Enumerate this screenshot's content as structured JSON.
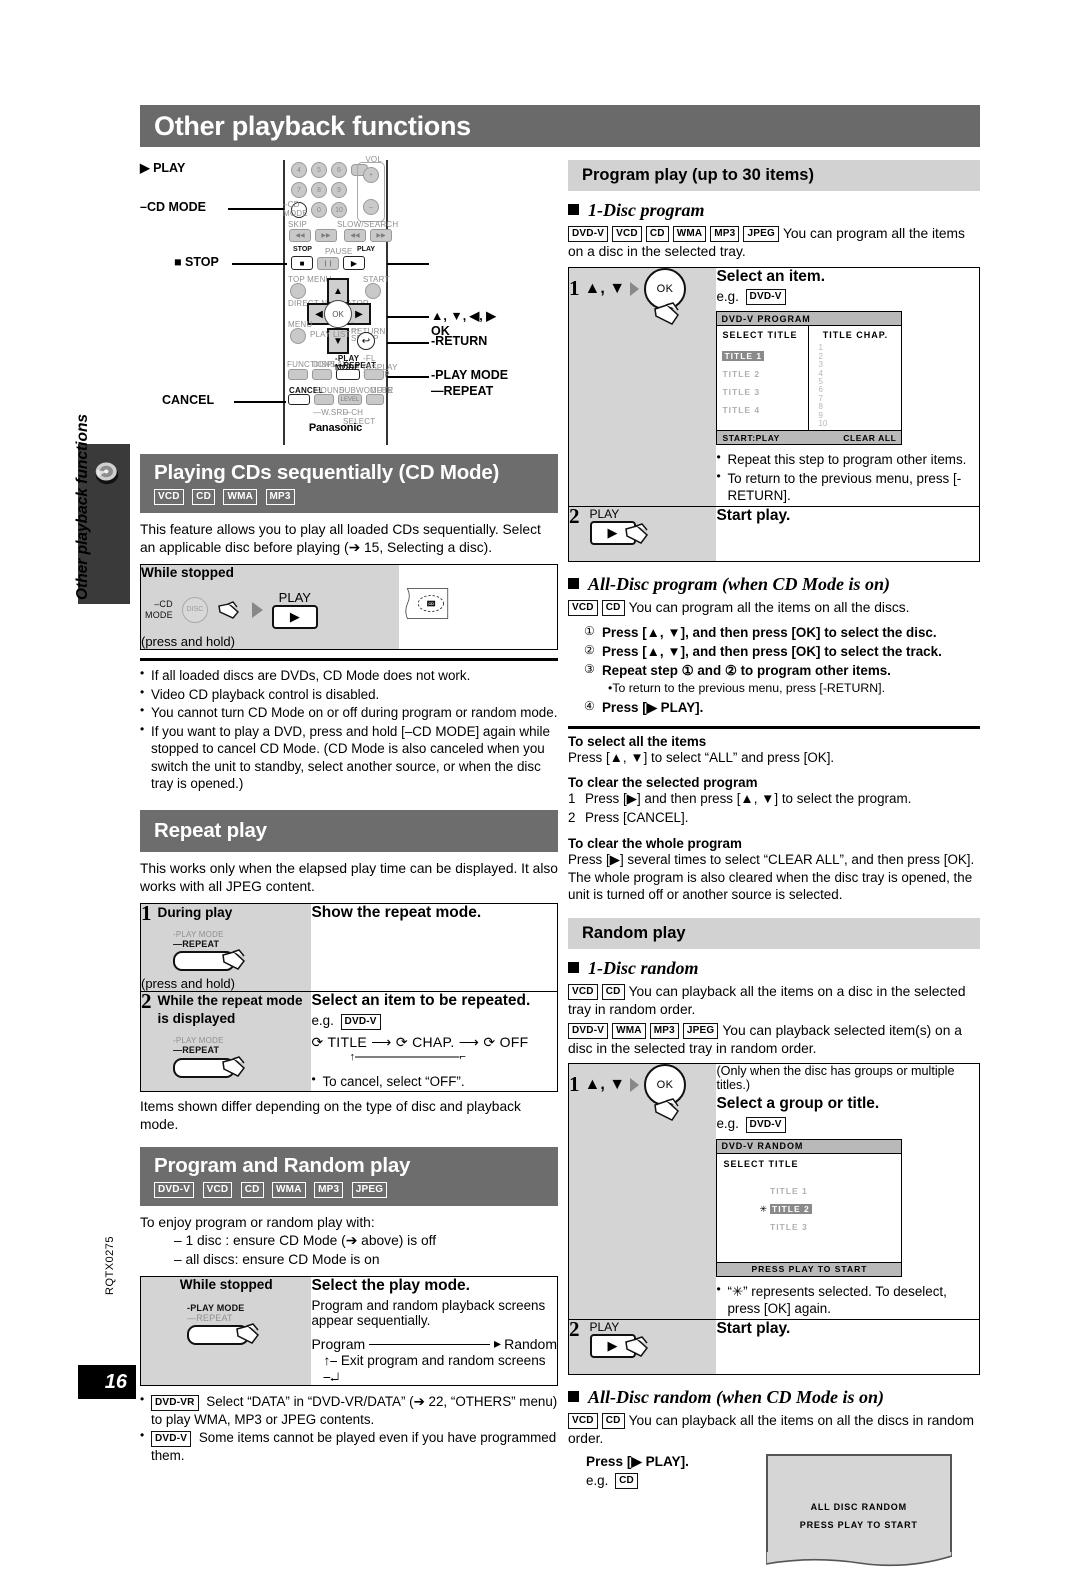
{
  "page": {
    "title": "Other playback functions",
    "side_label": "Other playback functions",
    "doc_code": "RQTX0275",
    "number": "16"
  },
  "remote": {
    "callouts": {
      "cd_mode": "–CD MODE",
      "stop": "■ STOP",
      "play": "▶ PLAY",
      "cursor": "▲, ▼, ◀, ▶",
      "ok": "OK",
      "ret": "-RETURN",
      "play_mode": "-PLAY MODE",
      "repeat": "—REPEAT",
      "cancel": "CANCEL"
    },
    "keys": {
      "n4": "4",
      "n5": "5",
      "n6": "6",
      "n7": "7",
      "n8": "8",
      "n9": "9",
      "n0": "0",
      "n10": "10",
      "vol": "VOL",
      "plus": "+",
      "minus": "–",
      "cdmode_l1": "–CD",
      "cdmode_l2": "MODE",
      "skip": "SKIP",
      "slowsearch": "SLOW/SEARCH",
      "stop": "STOP",
      "pause": "PAUSE",
      "play": "PLAY",
      "topmenu": "TOP MENU",
      "start": "START",
      "direct": "DIRECT NAVIGATOR",
      "menu": "MENU",
      "playlist": "PLAY LIST",
      "ok": "OK",
      "return_l1": "-RETURN",
      "return_l2": "—SETUP",
      "functions": "FUNCTIONS",
      "display": "DISPLAY",
      "playmode": "-PLAY MODE",
      "repeat": "—REPEAT",
      "fl_display": "-FL DISPLAY",
      "sleep": "—SLEEP",
      "cancel": "CANCEL",
      "sound": "SOUND",
      "subwoofer": "SUBWOOFER",
      "level": "LEVEL",
      "mute": "MUTE",
      "wsrd": "—W.SRD",
      "chselect": "—CH SELECT",
      "brand": "Panasonic"
    }
  },
  "cd_mode": {
    "heading": "Playing CDs sequentially (CD Mode)",
    "badges": [
      "VCD",
      "CD",
      "WMA",
      "MP3"
    ],
    "intro": "This feature allows you to play all loaded CDs sequentially. Select an applicable disc before playing (➔ 15, Selecting a disc).",
    "step": {
      "condition": "While stopped",
      "cdmode_l1": "–CD",
      "cdmode_l2": "MODE",
      "disc_label": "DISC",
      "play_label": "PLAY",
      "press_hold": "(press and hold)",
      "display_text": "CD"
    },
    "notes": [
      "If all loaded discs are DVDs, CD Mode does not work.",
      "Video CD playback control is disabled.",
      "You cannot turn CD Mode on or off during program or random mode.",
      "If you want to play a DVD, press and hold [–CD MODE] again while stopped to cancel CD Mode. (CD Mode is also canceled when you switch the unit to standby, select another source, or when the disc tray is opened.)"
    ]
  },
  "repeat_play": {
    "heading": "Repeat play",
    "intro": "This works only when the elapsed play time can be displayed. It also works with all JPEG content.",
    "steps": [
      {
        "num": "1",
        "condition": "During play",
        "key_l1": "-PLAY MODE",
        "key_l2": "—REPEAT",
        "press_hold": "(press and hold)",
        "head": "Show the repeat mode."
      },
      {
        "num": "2",
        "condition": "While the repeat mode is displayed",
        "key_l1": "-PLAY MODE",
        "key_l2": "—REPEAT",
        "press_hold": "",
        "head": "Select an item to be repeated.",
        "eg_label": "e.g.",
        "eg_badge": "DVD-V",
        "flow": [
          "TITLE",
          "CHAP.",
          "OFF"
        ],
        "note": "To cancel, select “OFF”."
      }
    ],
    "footer": "Items shown differ depending on the type of disc and playback mode."
  },
  "program_random": {
    "heading": "Program and Random play",
    "badges": [
      "DVD-V",
      "VCD",
      "CD",
      "WMA",
      "MP3",
      "JPEG"
    ],
    "intro": "To enjoy program or random play with:",
    "conditions": [
      "– 1 disc   : ensure CD Mode (➔ above) is off",
      "– all discs: ensure CD Mode is on"
    ],
    "step": {
      "condition": "While stopped",
      "key_l1": "-PLAY MODE",
      "key_l2": "—REPEAT",
      "head": "Select the play mode.",
      "sub": "Program and random playback screens appear sequentially.",
      "flow_from": "Program",
      "flow_to": "Random",
      "exit": "Exit program and random screens"
    },
    "notes": [
      {
        "badge": "DVD-VR",
        "text": "Select “DATA” in “DVD-VR/DATA” (➔ 22, “OTHERS” menu) to play WMA, MP3 or JPEG contents."
      },
      {
        "badge": "DVD-V",
        "text": "Some items cannot be played even if you have programmed them."
      }
    ]
  },
  "program_play": {
    "heading": "Program play (up to 30 items)",
    "one_disc": {
      "title": "1-Disc program",
      "badges": [
        "DVD-V",
        "VCD",
        "CD",
        "WMA",
        "MP3",
        "JPEG"
      ],
      "desc": "You can program all the items on a disc in the selected tray.",
      "steps": [
        {
          "num": "1",
          "keys": "▲, ▼",
          "ok": "OK",
          "head": "Select an item.",
          "eg_label": "e.g.",
          "eg_badge": "DVD-V",
          "notes": [
            "Repeat this step to program other items.",
            "To return to the previous menu, press [-RETURN]."
          ]
        },
        {
          "num": "2",
          "play_label": "PLAY",
          "head": "Start play."
        }
      ],
      "osd": {
        "title": "DVD-V  PROGRAM",
        "col_left_head": "SELECT TITLE",
        "col_right_head": "TITLE CHAP.",
        "titles": [
          "TITLE  1",
          "TITLE  2",
          "TITLE  3",
          "TITLE  4"
        ],
        "selected_index": 0,
        "chapters": [
          "1",
          "2",
          "3",
          "4",
          "5",
          "6",
          "7",
          "8",
          "9",
          "10"
        ],
        "foot_left": "START:PLAY",
        "foot_right": "CLEAR ALL"
      }
    },
    "all_disc": {
      "title": "All-Disc program (when CD Mode is on)",
      "badges": [
        "VCD",
        "CD"
      ],
      "desc": "You can program all the items on all the discs.",
      "steps": [
        {
          "num": "①",
          "text": "Press [▲, ▼], and then press [OK] to select the disc."
        },
        {
          "num": "②",
          "text": "Press [▲, ▼], and then press [OK] to select the track."
        },
        {
          "num": "③",
          "text": "Repeat step ① and ② to program other items.",
          "sub": "To return to the previous menu, press [-RETURN]."
        },
        {
          "num": "④",
          "text": "Press [▶ PLAY]."
        }
      ]
    },
    "howto": [
      {
        "head": "To select all the items",
        "paras": [
          "Press [▲, ▼] to select “ALL” and press [OK]."
        ]
      },
      {
        "head": "To clear the selected program",
        "numbered": [
          {
            "n": "1",
            "text": "Press [▶] and then press [▲, ▼] to select the program."
          },
          {
            "n": "2",
            "text": "Press [CANCEL]."
          }
        ]
      },
      {
        "head": "To clear the whole program",
        "paras": [
          "Press [▶] several times to select “CLEAR ALL”, and then press [OK].",
          "The whole program is also cleared when the disc tray is opened, the unit is turned off or another source is selected."
        ]
      }
    ]
  },
  "random_play": {
    "heading": "Random play",
    "one_disc": {
      "title": "1-Disc random",
      "badges_a": [
        "VCD",
        "CD"
      ],
      "desc_a": "You can playback all the items on a disc in the selected tray in random order.",
      "badges_b": [
        "DVD-V",
        "WMA",
        "MP3",
        "JPEG"
      ],
      "desc_b": "You can playback selected item(s) on a disc in the selected tray in random order.",
      "steps": [
        {
          "num": "1",
          "keys": "▲, ▼",
          "ok": "OK",
          "pre_note": "(Only when the disc has groups or multiple titles.)",
          "head": "Select a group or title.",
          "eg_label": "e.g.",
          "eg_badge": "DVD-V",
          "note": "“✳” represents selected. To deselect, press [OK] again."
        },
        {
          "num": "2",
          "play_label": "PLAY",
          "head": "Start play."
        }
      ],
      "osd": {
        "title": "DVD-V  RANDOM",
        "head": "SELECT TITLE",
        "titles": [
          "TITLE  1",
          "TITLE  2",
          "TITLE  3"
        ],
        "selected_index": 1,
        "star": "✳",
        "foot": "PRESS PLAY TO START"
      }
    },
    "all_disc": {
      "title": "All-Disc random (when CD Mode is on)",
      "badges": [
        "VCD",
        "CD"
      ],
      "desc": "You can playback all the items on all the discs in random order.",
      "press": "Press [▶ PLAY].",
      "eg_label": "e.g.",
      "eg_badge": "CD",
      "screen_line1": "ALL DISC RANDOM",
      "screen_line2": "PRESS PLAY TO START"
    }
  }
}
